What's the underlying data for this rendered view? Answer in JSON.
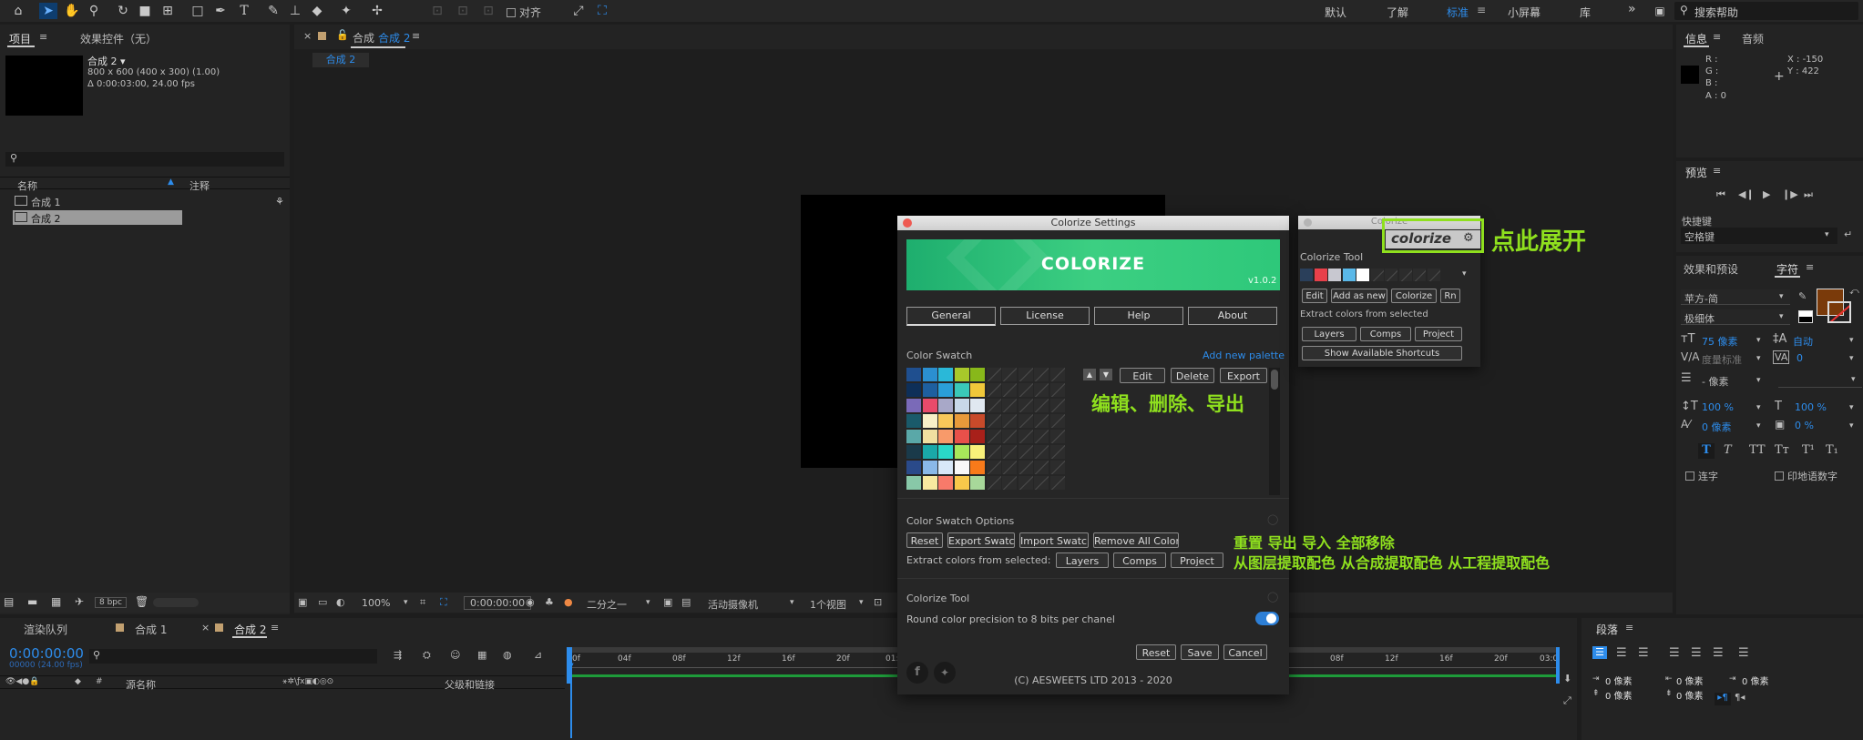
{
  "toolbar": {
    "align_label": "对齐",
    "workspaces": [
      "默认",
      "了解",
      "标准",
      "小屏幕",
      "库"
    ],
    "more": "»",
    "search_placeholder": "搜索帮助"
  },
  "project_panel": {
    "tab_project": "项目",
    "tab_effects": "效果控件（无）",
    "comp_title": "合成 2 ▾",
    "comp_info1": "800 x 600  (400 x 300) (1.00)",
    "comp_info2": "Δ 0:00:03:00, 24.00 fps",
    "col_name": "名称",
    "col_comment": "注释",
    "items": [
      "合成 1",
      "合成 2"
    ],
    "bpc": "8 bpc"
  },
  "comp_viewer": {
    "tab_label": "合成 合成 2",
    "tab_prefix": "合成",
    "tab_name": "合成 2",
    "subtab": "合成 2",
    "zoom": "100%",
    "timecode": "0:00:00:00",
    "resolution": "二分之一",
    "camera": "活动摄像机",
    "views": "1个视图"
  },
  "info_panel": {
    "tab_info": "信息",
    "tab_audio": "音频",
    "r": "R :",
    "g": "G :",
    "b": "B :",
    "a": "A :  0",
    "x": "X : -150",
    "y": "Y :  422"
  },
  "preview_panel": {
    "title": "预览",
    "shortcut_label": "快捷键",
    "shortcut_value": "空格键"
  },
  "character_panel": {
    "tab_effects": "效果和预设",
    "tab_character": "字符",
    "font": "苹方-简",
    "style": "极细体",
    "size": "75 像素",
    "leading": "自动",
    "kerning": "度量标准",
    "tracking": "0",
    "stroke": "- 像素",
    "vscale": "100 %",
    "hscale": "100 %",
    "baseline": "0 像素",
    "tsume": "0 %",
    "ligature": "连字",
    "hindi": "印地语数字",
    "fill_color": "#7a3a0a"
  },
  "paragraph_panel": {
    "title": "段落",
    "indent_values": [
      "0 像素",
      "0 像素",
      "0 像素",
      "0 像素",
      "0 像素"
    ]
  },
  "timeline": {
    "tab_render": "渲染队列",
    "tab_comp1": "合成 1",
    "tab_comp2": "合成 2",
    "timecode": "0:00:00:00",
    "frames": "00000 (24.00 fps)",
    "col_source": "源名称",
    "col_parent": "父级和链接",
    "ruler_left": [
      "0f",
      "04f",
      "08f",
      "12f",
      "16f",
      "20f",
      "01:"
    ],
    "ruler_right": [
      "08f",
      "12f",
      "16f",
      "20f",
      "03:0"
    ]
  },
  "colorize_settings": {
    "window_title": "Colorize Settings",
    "banner_title": "COLORIZE",
    "version": "v1.0.2",
    "tabs": [
      "General",
      "License",
      "Help",
      "About"
    ],
    "swatch_label": "Color Swatch",
    "add_palette": "Add new palette",
    "edit": "Edit",
    "delete": "Delete",
    "export": "Export",
    "swatch_options_label": "Color Swatch Options",
    "reset": "Reset",
    "export_swatch": "Export Swatch",
    "import_swatch": "Import Swatch",
    "remove_all": "Remove All Colors",
    "extract_label": "Extract colors from selected:",
    "layers": "Layers",
    "comps": "Comps",
    "project": "Project",
    "tool_label": "Colorize Tool",
    "round_label": "Round color precision to 8 bits per chanel",
    "reset2": "Reset",
    "save": "Save",
    "cancel": "Cancel",
    "copyright": "(C) AESWEETS LTD 2013 - 2020",
    "palette": [
      [
        "#1f4f8f",
        "#2b8fd0",
        "#2ab8d8",
        "#a8c82a",
        "#88b81a"
      ],
      [
        "#0e2f58",
        "#1e5f9f",
        "#2a9fd8",
        "#3ac8b8",
        "#f0c83a"
      ],
      [
        "#7a6ab8",
        "#e84a6a",
        "#a8a8c8",
        "#c8d8e8",
        "#e0e8f0"
      ],
      [
        "#1a5a6a",
        "#f8f0c8",
        "#f8c85a",
        "#e89a3a",
        "#c84a2a"
      ],
      [
        "#5aa8a8",
        "#f0e0a0",
        "#f89a6a",
        "#e8504a",
        "#a8201a"
      ],
      [
        "#1a3a4a",
        "#1aa8a8",
        "#2ad8c8",
        "#a8e85a",
        "#f8f07a"
      ],
      [
        "#2a4a8a",
        "#8ab8e8",
        "#d8e8f8",
        "#f8f8f8",
        "#f87a1a"
      ],
      [
        "#88c8a8",
        "#f8e8a0",
        "#f87a6a",
        "#f8c84a",
        "#a8d89a"
      ]
    ]
  },
  "colorize_tool": {
    "window_title": "Colorize",
    "logo": "colorize",
    "label": "Colorize Tool",
    "colors": [
      "#2a3f5a",
      "#e8404a",
      "#c8c8d0",
      "#5ab8e8",
      "#ffffff"
    ],
    "edit": "Edit",
    "add_new": "Add as new",
    "colorize": "Colorize",
    "rn": "Rn",
    "extract_label": "Extract colors from selected",
    "layers": "Layers",
    "comps": "Comps",
    "project": "Project",
    "shortcuts": "Show Available Shortcuts"
  },
  "annotations": {
    "expand": "点此展开",
    "edit_delete_export": "编辑、删除、导出",
    "row1": "重置    导出  导入  全部移除",
    "row2": "从图层提取配色  从合成提取配色  从工程提取配色"
  }
}
